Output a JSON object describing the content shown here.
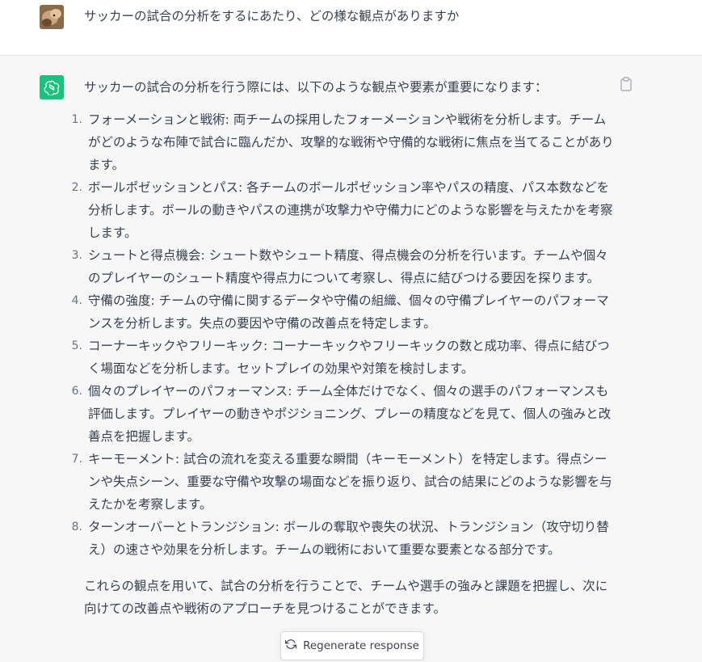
{
  "user_message": {
    "avatar": "user-avatar-photo",
    "text": "サッカーの試合の分析をするにあたり、どの様な観点がありますか"
  },
  "assistant_message": {
    "avatar": "openai-logo-icon",
    "intro": "サッカーの試合の分析を行う際には、以下のような観点や要素が重要になります：",
    "items": [
      {
        "num": "1.",
        "text": "フォーメーションと戦術: 両チームの採用したフォーメーションや戦術を分析します。チームがどのような布陣で試合に臨んだか、攻撃的な戦術や守備的な戦術に焦点を当てることがあります。"
      },
      {
        "num": "2.",
        "text": "ボールポゼッションとパス: 各チームのボールポゼッション率やパスの精度、パス本数などを分析します。ボールの動きやパスの連携が攻撃力や守備力にどのような影響を与えたかを考察します。"
      },
      {
        "num": "3.",
        "text": "シュートと得点機会: シュート数やシュート精度、得点機会の分析を行います。チームや個々のプレイヤーのシュート精度や得点力について考察し、得点に結びつける要因を探ります。"
      },
      {
        "num": "4.",
        "text": "守備の強度: チームの守備に関するデータや守備の組織、個々の守備プレイヤーのパフォーマンスを分析します。失点の要因や守備の改善点を特定します。"
      },
      {
        "num": "5.",
        "text": "コーナーキックやフリーキック: コーナーキックやフリーキックの数と成功率、得点に結びつく場面などを分析します。セットプレイの効果や対策を検討します。"
      },
      {
        "num": "6.",
        "text": "個々のプレイヤーのパフォーマンス: チーム全体だけでなく、個々の選手のパフォーマンスも評価します。プレイヤーの動きやポジショニング、プレーの精度などを見て、個人の強みと改善点を把握します。"
      },
      {
        "num": "7.",
        "text": "キーモーメント: 試合の流れを変える重要な瞬間（キーモーメント）を特定します。得点シーンや失点シーン、重要な守備や攻撃の場面などを振り返り、試合の結果にどのような影響を与えたかを考察します。"
      },
      {
        "num": "8.",
        "text": "ターンオーバーとトランジション: ボールの奪取や喪失の状況、トランジション（攻守切り替え）の速さや効果を分析します。チームの戦術において重要な要素となる部分です。"
      }
    ],
    "conclusion": "これらの観点を用いて、試合の分析を行うことで、チームや選手の強みと課題を把握し、次に向けての改善点や戦術のアプローチを見つけることができます。"
  },
  "regenerate_button": {
    "icon": "refresh-icon",
    "label": "Regenerate response"
  },
  "colors": {
    "assistant_bg": "#f7f7f8",
    "gpt_green": "#19c37d",
    "text": "#374151"
  }
}
